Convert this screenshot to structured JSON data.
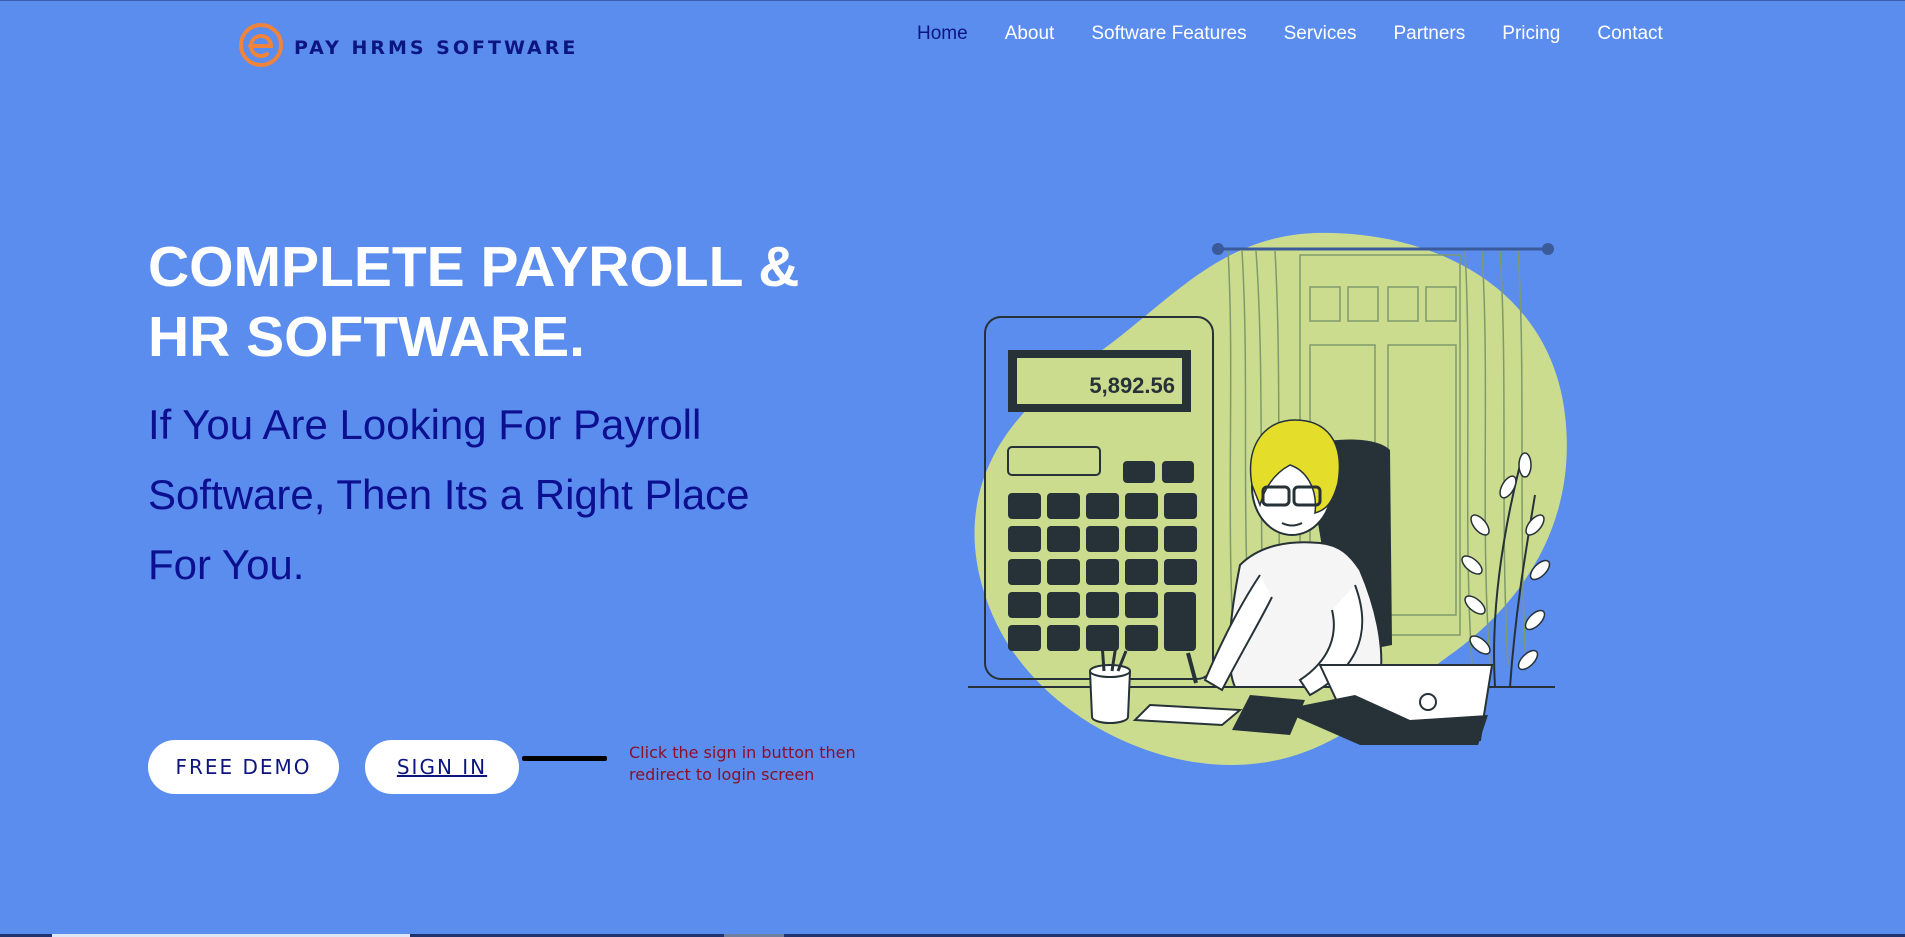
{
  "brand": {
    "name": "PAY HRMS SOFTWARE",
    "logo_letter": "e",
    "logo_color": "#f0843a",
    "text_color": "#0c1580"
  },
  "nav": {
    "items": [
      {
        "label": "Home",
        "active": true
      },
      {
        "label": "About"
      },
      {
        "label": "Software Features"
      },
      {
        "label": "Services"
      },
      {
        "label": "Partners"
      },
      {
        "label": "Pricing"
      },
      {
        "label": "Contact"
      }
    ]
  },
  "hero": {
    "title_line1": "COMPLETE PAYROLL &",
    "title_line2": "HR SOFTWARE.",
    "subtitle_line1": "If You Are Looking For Payroll",
    "subtitle_line2": "Software, Then Its a Right Place",
    "subtitle_line3": "For You."
  },
  "buttons": {
    "demo_label": "FREE DEMO",
    "signin_label": "SIGN IN"
  },
  "annotation": {
    "line1": "Click the sign in button then",
    "line2": "redirect to login screen"
  },
  "illustration": {
    "calculator_display": "5,892.56",
    "icon": "accountant-at-desk-illustration"
  },
  "colors": {
    "background": "#5b8def",
    "accent_navy": "#0c1580",
    "blob": "#ccdc8f",
    "dark": "#263238"
  }
}
